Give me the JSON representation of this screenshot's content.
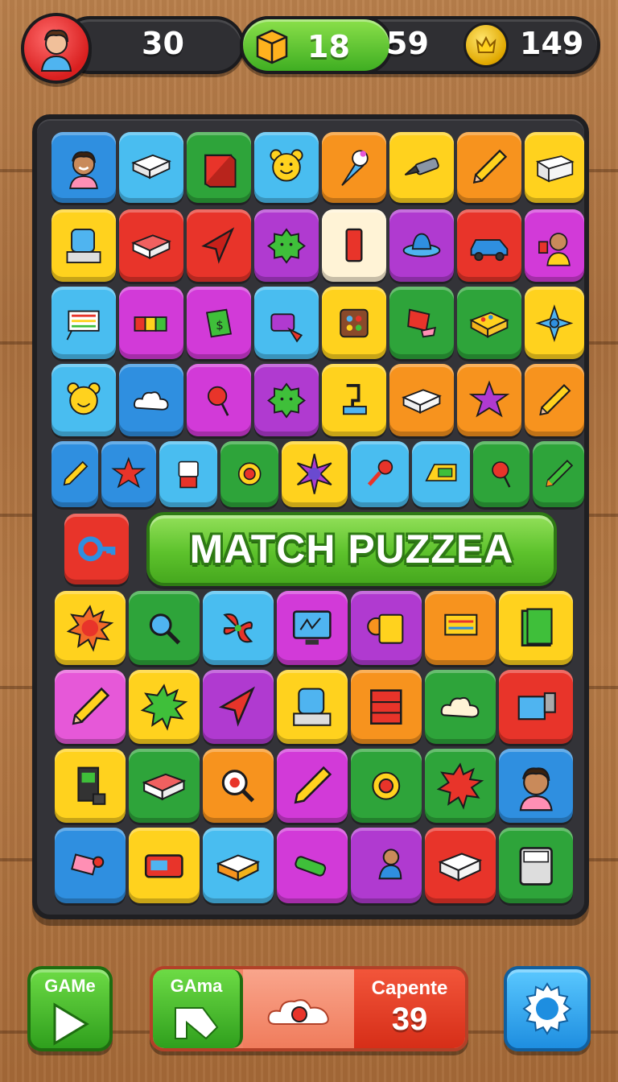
{
  "hud": {
    "player_score": "30",
    "blocks_count": "18",
    "moves": "59",
    "coins": "149",
    "icons": [
      "avatar-icon",
      "block-icon",
      "coin-icon"
    ]
  },
  "board": {
    "banner_text": "MATCH PUZZEA",
    "rows": [
      [
        "face-icon",
        "book-icon",
        "box-icon",
        "bear-icon",
        "cone-icon",
        "tool-icon",
        "pencil-icon",
        "printer-icon"
      ],
      [
        "machine-icon",
        "book-icon",
        "kite-icon",
        "blob-icon",
        "domino-icon",
        "hat-icon",
        "car-icon",
        "person-icon"
      ],
      [
        "abacus-icon",
        "blocks-icon",
        "money-icon",
        "gadget-icon",
        "palette-icon",
        "flag-icon",
        "gamebox-icon",
        "flower-icon"
      ],
      [
        "bear-icon",
        "cloud-icon",
        "pin-icon",
        "blob-icon",
        "lamp-icon",
        "book-icon",
        "star-icon",
        "pencil-icon"
      ],
      [
        "pencil-icon",
        "star-icon",
        "robot-icon",
        "gear-icon",
        "spark-icon",
        "pin-icon",
        "keyboard-icon",
        "pin-icon",
        "pencil-icon"
      ],
      [
        "key-icon"
      ],
      [
        "sun-icon",
        "magnifier-icon",
        "fan-icon",
        "monitor-icon",
        "register-icon",
        "abacus-icon",
        "book-icon"
      ],
      [
        "pencil-icon",
        "sun-icon",
        "kite-icon",
        "machine-icon",
        "cabinet-icon",
        "cloud-icon",
        "engine-icon"
      ],
      [
        "arcade-icon",
        "book-icon",
        "magnifier-icon",
        "pencil-icon",
        "gear-icon",
        "sun-icon",
        "face-icon"
      ],
      [
        "toy-icon",
        "radio-icon",
        "cake-icon",
        "marker-icon",
        "baby-icon",
        "cards-icon",
        "calculator-icon"
      ]
    ]
  },
  "bottom": {
    "left_label": "GAMe",
    "mid_label": "GAma",
    "right_label": "Capente",
    "right_count": "39",
    "icons": [
      "play-icon",
      "flag-icon",
      "cloud-icon",
      "settings-gear-icon"
    ]
  },
  "colors": {
    "board_bg": "#333338",
    "banner_green": "#5dc22c",
    "settings_blue": "#1e8ee0"
  }
}
